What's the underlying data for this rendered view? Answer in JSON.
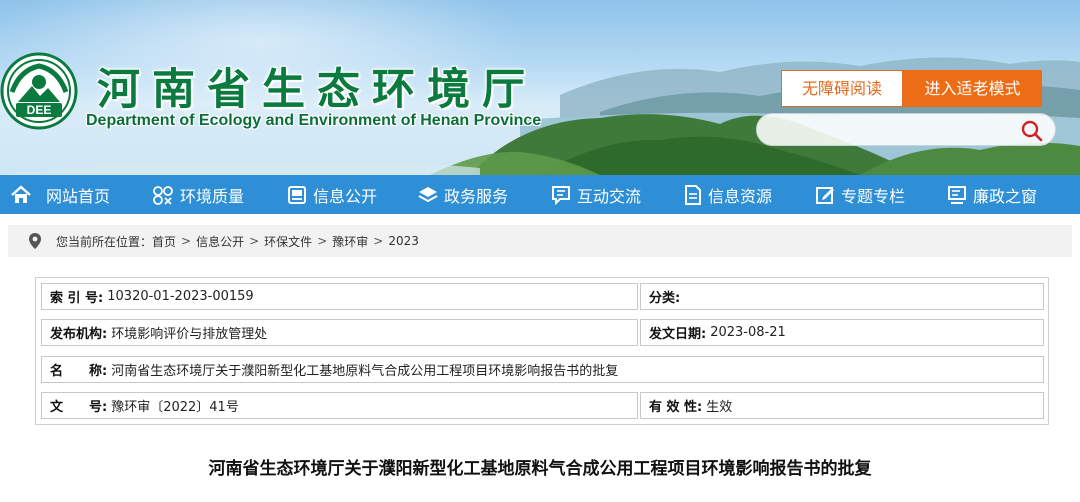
{
  "header": {
    "logo_text": "DEE",
    "title": "河南省生态环境厅",
    "subtitle": "Department of Ecology and Environment of Henan Province",
    "accessibility_label": "无障碍阅读",
    "elder_mode_label": "进入适老模式",
    "search_placeholder": ""
  },
  "nav": {
    "items": [
      {
        "label": "网站首页",
        "icon": "home-icon"
      },
      {
        "label": "环境质量",
        "icon": "flower-icon"
      },
      {
        "label": "信息公开",
        "icon": "document-icon"
      },
      {
        "label": "政务服务",
        "icon": "layers-icon"
      },
      {
        "label": "互动交流",
        "icon": "chat-icon"
      },
      {
        "label": "信息资源",
        "icon": "file-icon"
      },
      {
        "label": "专题专栏",
        "icon": "edit-icon"
      },
      {
        "label": "廉政之窗",
        "icon": "monitor-icon"
      }
    ]
  },
  "breadcrumb": {
    "prefix": "您当前所在位置：",
    "items": [
      "首页",
      "信息公开",
      "环保文件",
      "豫环审",
      "2023"
    ],
    "separator": ">"
  },
  "info": {
    "index_label": "索 引 号:",
    "index_value": "10320-01-2023-00159",
    "category_label": "分类:",
    "category_value": "",
    "publisher_label": "发布机构:",
    "publisher_value": "环境影响评价与排放管理处",
    "date_label": "发文日期:",
    "date_value": "2023-08-21",
    "name_label": "名　　称:",
    "name_value": "河南省生态环境厅关于濮阳新型化工基地原料气合成公用工程项目环境影响报告书的批复",
    "docno_label": "文　　号:",
    "docno_value": "豫环审〔2022〕41号",
    "validity_label": "有 效 性:",
    "validity_value": "生效"
  },
  "article": {
    "title": "河南省生态环境厅关于濮阳新型化工基地原料气合成公用工程项目环境影响报告书的批复"
  },
  "colors": {
    "brand_green": "#0a7a3e",
    "nav_blue": "#2f8fd6",
    "accent_orange": "#ec6d15"
  }
}
